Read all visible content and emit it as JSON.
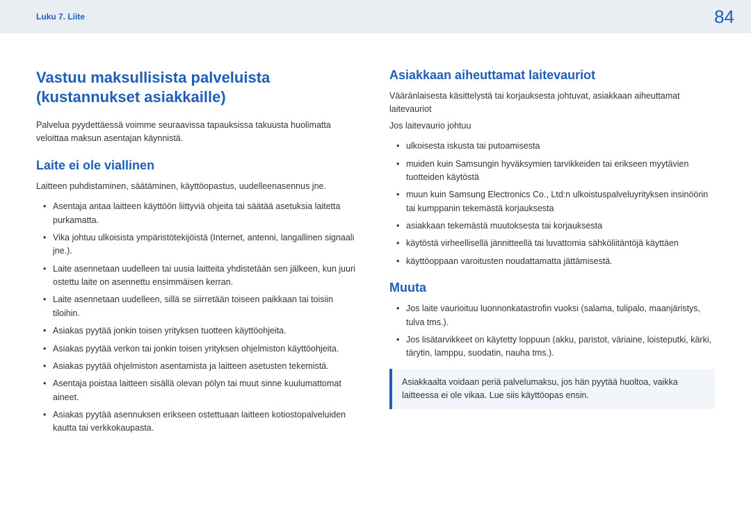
{
  "header": {
    "chapter": "Luku 7. Liite",
    "page": "84"
  },
  "left": {
    "title": "Vastuu maksullisista palveluista (kustannukset asiakkaille)",
    "intro": "Palvelua pyydettäessä voimme seuraavissa tapauksissa takuusta huolimatta veloittaa maksun asentajan käynnistä.",
    "section1_title": "Laite ei ole viallinen",
    "section1_intro": "Laitteen puhdistaminen, säätäminen, käyttöopastus, uudelleenasennus jne.",
    "section1_items": [
      "Asentaja antaa laitteen käyttöön liittyviä ohjeita tai säätää asetuksia laitetta purkamatta.",
      "Vika johtuu ulkoisista ympäristötekijöistä (Internet, antenni, langallinen signaali jne.).",
      "Laite asennetaan uudelleen tai uusia laitteita yhdistetään sen jälkeen, kun juuri ostettu laite on asennettu ensimmäisen kerran.",
      "Laite asennetaan uudelleen, sillä se siirretään toiseen paikkaan tai toisiin tiloihin.",
      "Asiakas pyytää jonkin toisen yrityksen tuotteen käyttöohjeita.",
      "Asiakas pyytää verkon tai jonkin toisen yrityksen ohjelmiston käyttöohjeita.",
      "Asiakas pyytää ohjelmiston asentamista ja laitteen asetusten tekemistä.",
      "Asentaja poistaa laitteen sisällä olevan pölyn tai muut sinne kuulumattomat aineet.",
      "Asiakas pyytää asennuksen erikseen ostettuaan laitteen kotiostopalveluiden kautta tai verkkokaupasta."
    ]
  },
  "right": {
    "section2_title": "Asiakkaan aiheuttamat laitevauriot",
    "section2_intro1": "Vääränlaisesta käsittelystä tai korjauksesta johtuvat, asiakkaan aiheuttamat laitevauriot",
    "section2_intro2": "Jos laitevaurio johtuu",
    "section2_items": [
      "ulkoisesta iskusta tai putoamisesta",
      "muiden kuin Samsungin hyväksymien tarvikkeiden tai erikseen myytävien tuotteiden käytöstä",
      "muun kuin Samsung Electronics Co., Ltd:n ulkoistuspalveluyrityksen insinöörin tai kumppanin tekemästä korjauksesta",
      "asiakkaan tekemästä muutoksesta tai korjauksesta",
      "käytöstä virheellisellä jännitteellä tai luvattomia sähköliitäntöjä käyttäen",
      "käyttöoppaan varoitusten noudattamatta jättämisestä."
    ],
    "section3_title": "Muuta",
    "section3_items": [
      "Jos laite vaurioituu luonnonkatastrofin vuoksi (salama, tulipalo, maanjäristys, tulva tms.).",
      "Jos lisätarvikkeet on käytetty loppuun (akku, paristot, väriaine, loisteputki, kärki, tärytin, lamppu, suodatin, nauha tms.)."
    ],
    "note": "Asiakkaalta voidaan periä palvelumaksu, jos hän pyytää huoltoa, vaikka laitteessa ei ole vikaa. Lue siis käyttöopas ensin."
  }
}
